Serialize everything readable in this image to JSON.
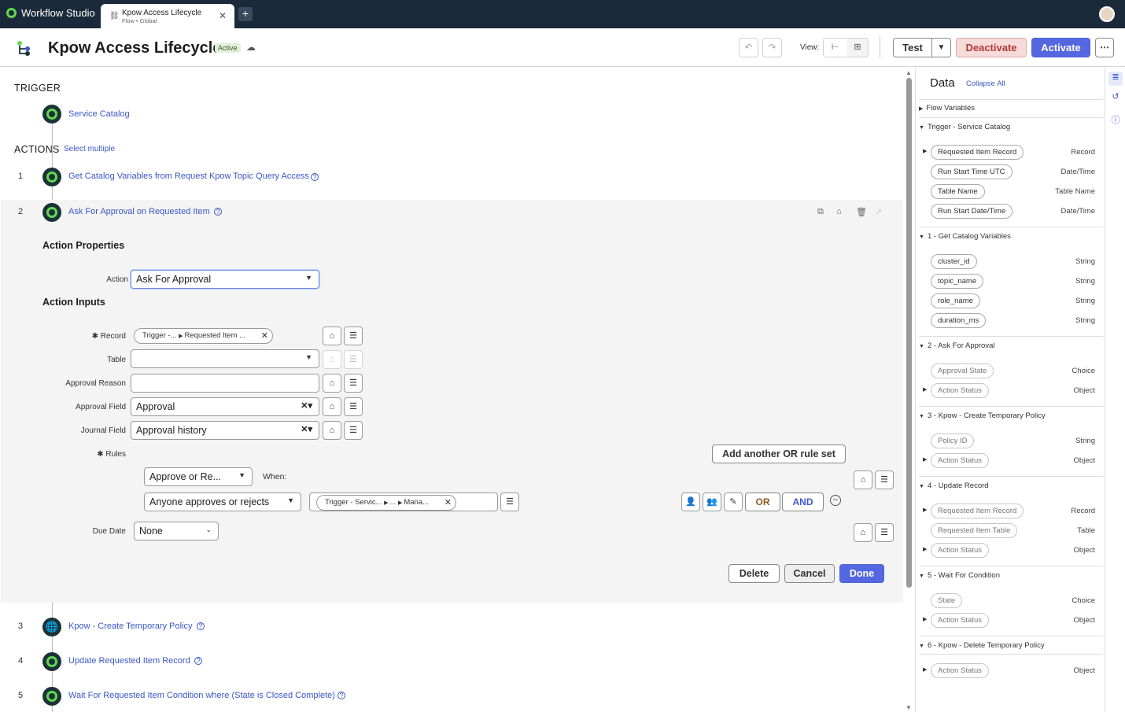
{
  "app": {
    "title": "Workflow Studio"
  },
  "tab": {
    "title": "Kpow Access Lifecycle",
    "subtitle": "Flow • Global",
    "add": "+",
    "close": "✕"
  },
  "header": {
    "title": "Kpow Access Lifecycle",
    "status": "Active",
    "view_label": "View:",
    "test": "Test",
    "deactivate": "Deactivate",
    "activate": "Activate",
    "more": "⋯"
  },
  "trigger": {
    "label": "TRIGGER",
    "name": "Service Catalog"
  },
  "actions": {
    "label": "ACTIONS",
    "select_multiple": "Select multiple",
    "steps": [
      {
        "num": "1",
        "name": "Get Catalog Variables from Request Kpow Topic Query Access"
      },
      {
        "num": "2",
        "name": "Ask For Approval on Requested Item"
      },
      {
        "num": "3",
        "name": "Kpow - Create Temporary Policy"
      },
      {
        "num": "4",
        "name": "Update Requested Item Record"
      },
      {
        "num": "5",
        "name": "Wait For Requested Item Condition where (State is Closed Complete)"
      }
    ]
  },
  "editor": {
    "action_properties": "Action Properties",
    "action_label": "Action",
    "action_value": "Ask For Approval",
    "action_inputs": "Action Inputs",
    "record_label": "Record",
    "record_pill_a": "Trigger -...",
    "record_pill_b": "Requested Item ...",
    "table_label": "Table",
    "approval_reason_label": "Approval Reason",
    "approval_field_label": "Approval Field",
    "approval_field_value": "Approval",
    "journal_field_label": "Journal Field",
    "journal_field_value": "Approval history",
    "rules_label": "Rules",
    "add_or_rule": "Add another OR rule set",
    "rule_action": "Approve or Re...",
    "when_label": "When:",
    "rule_condition": "Anyone approves or rejects",
    "rule_pill_a": "Trigger - Servic...",
    "rule_pill_b": "...",
    "rule_pill_c": "Mana...",
    "or_label": "OR",
    "and_label": "AND",
    "due_date_label": "Due Date",
    "due_date_value": "None",
    "delete": "Delete",
    "cancel": "Cancel",
    "done": "Done"
  },
  "data_panel": {
    "title": "Data",
    "collapse_all": "Collapse All",
    "sections": [
      {
        "title": "Flow Variables",
        "items": []
      },
      {
        "title": "Trigger - Service Catalog",
        "items": [
          {
            "name": "Requested Item Record",
            "type": "Record"
          },
          {
            "name": "Run Start Time UTC",
            "type": "Date/Time"
          },
          {
            "name": "Table Name",
            "type": "Table Name"
          },
          {
            "name": "Run Start Date/Time",
            "type": "Date/Time"
          }
        ]
      },
      {
        "title": "1 - Get Catalog Variables",
        "items": [
          {
            "name": "cluster_id",
            "type": "String"
          },
          {
            "name": "topic_name",
            "type": "String"
          },
          {
            "name": "role_name",
            "type": "String"
          },
          {
            "name": "duration_ms",
            "type": "String"
          }
        ]
      },
      {
        "title": "2 - Ask For Approval",
        "items": [
          {
            "name": "Approval State",
            "type": "Choice"
          },
          {
            "name": "Action Status",
            "type": "Object"
          }
        ]
      },
      {
        "title": "3 - Kpow - Create Temporary Policy",
        "items": [
          {
            "name": "Policy ID",
            "type": "String"
          },
          {
            "name": "Action Status",
            "type": "Object"
          }
        ]
      },
      {
        "title": "4 - Update Record",
        "items": [
          {
            "name": "Requested Item Record",
            "type": "Record"
          },
          {
            "name": "Requested Item Table",
            "type": "Table"
          },
          {
            "name": "Action Status",
            "type": "Object"
          }
        ]
      },
      {
        "title": "5 - Wait For Condition",
        "items": [
          {
            "name": "State",
            "type": "Choice"
          },
          {
            "name": "Action Status",
            "type": "Object"
          }
        ]
      },
      {
        "title": "6 - Kpow - Delete Temporary Policy",
        "items": [
          {
            "name": "Action Status",
            "type": "Object"
          }
        ]
      }
    ]
  },
  "colors": {
    "accent": "#5467e0",
    "link": "#3b57c9",
    "topbar": "#1b2a3a",
    "brand_green": "#62d84e",
    "danger": "#b13a3a"
  }
}
